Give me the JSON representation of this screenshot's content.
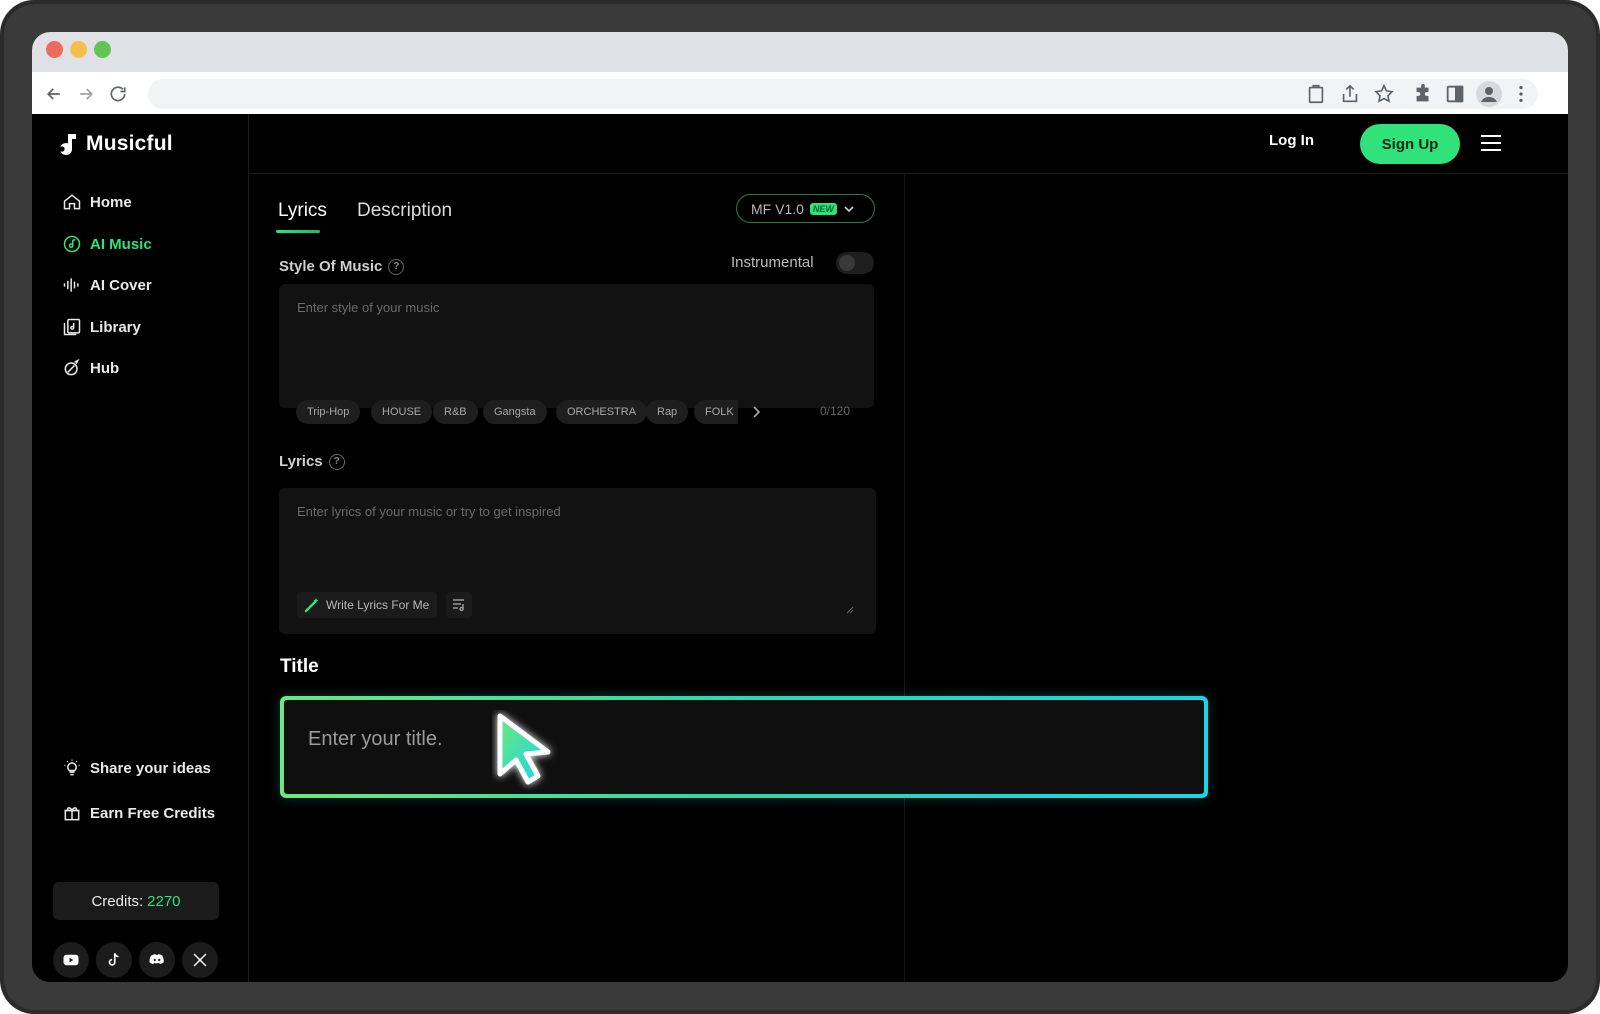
{
  "app": {
    "name": "Musicful"
  },
  "sidebar": {
    "items": [
      {
        "label": "Home",
        "icon": "home-icon"
      },
      {
        "label": "AI Music",
        "icon": "ai-music-icon"
      },
      {
        "label": "AI Cover",
        "icon": "waveform-icon"
      },
      {
        "label": "Library",
        "icon": "library-icon"
      },
      {
        "label": "Hub",
        "icon": "hub-icon"
      }
    ],
    "active": "AI Music",
    "bottom": {
      "share_label": "Share your ideas",
      "earn_label": "Earn Free Credits",
      "credits_label": "Credits:",
      "credits_value": "2270"
    },
    "social": [
      "youtube-icon",
      "tiktok-icon",
      "discord-icon",
      "x-icon"
    ]
  },
  "header": {
    "login_label": "Log In",
    "signup_label": "Sign Up"
  },
  "main": {
    "tabs": [
      {
        "label": "Lyrics",
        "active": true
      },
      {
        "label": "Description",
        "active": false
      }
    ],
    "model": {
      "label": "MF V1.0",
      "badge": "NEW"
    },
    "style": {
      "label": "Style Of Music",
      "placeholder": "Enter style of your music",
      "chips": [
        "Trip-Hop",
        "HOUSE",
        "R&B",
        "Gangsta",
        "ORCHESTRA",
        "Rap",
        "FOLK"
      ],
      "count": "0/120"
    },
    "instrumental": {
      "label": "Instrumental",
      "on": false
    },
    "lyrics": {
      "label": "Lyrics",
      "placeholder": "Enter lyrics of your music or try to get inspired",
      "write_button": "Write Lyrics For Me"
    },
    "title": {
      "label": "Title",
      "placeholder": "Enter your title."
    }
  },
  "colors": {
    "accent": "#2fe27a",
    "title_gradient_start": "#6fe67f",
    "title_gradient_end": "#17d6e6",
    "background": "#000000"
  }
}
